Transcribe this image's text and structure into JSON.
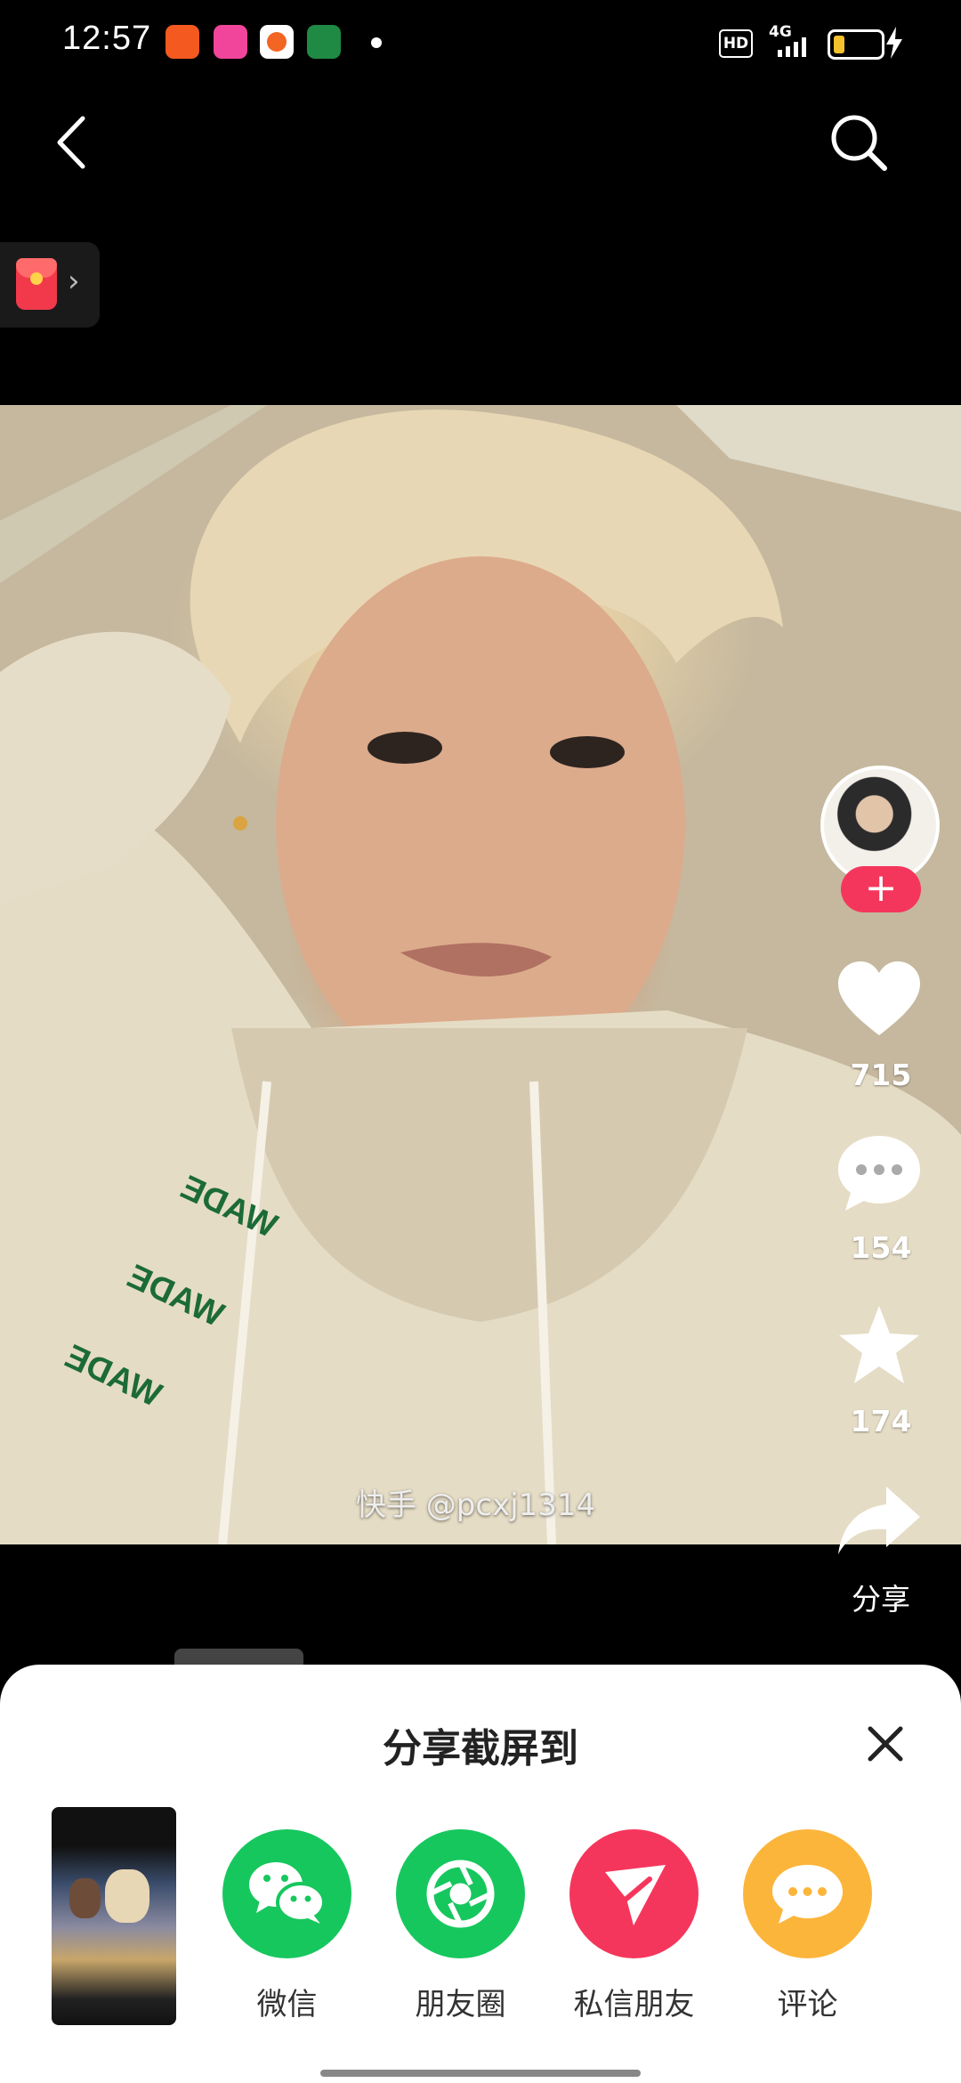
{
  "status_bar": {
    "time": "12:57",
    "network": "4G",
    "hd_badge": "HD",
    "app_icon_colors": [
      "#f45a1f",
      "#f0459a",
      "#f26522",
      "#1f8a43"
    ]
  },
  "nav": {
    "back_icon": "chevron-left-icon",
    "search_icon": "search-icon"
  },
  "red_packet": {
    "icon": "red-envelope-icon",
    "chevron": "›"
  },
  "video": {
    "watermark": "快手 @pcxj1314"
  },
  "right_rail": {
    "follow_label": "+",
    "like_count": "715",
    "comment_count": "154",
    "favorite_count": "174",
    "share_label": "分享",
    "accent_color": "#f5365c"
  },
  "share_sheet": {
    "title": "分享截屏到",
    "options": [
      {
        "label": "微信",
        "icon": "wechat-icon",
        "color": "#16c75e"
      },
      {
        "label": "朋友圈",
        "icon": "moments-icon",
        "color": "#16c75e"
      },
      {
        "label": "私信朋友",
        "icon": "paper-plane-icon",
        "color": "#f5365c"
      },
      {
        "label": "评论",
        "icon": "comment-icon",
        "color": "#fcb53b"
      }
    ]
  }
}
